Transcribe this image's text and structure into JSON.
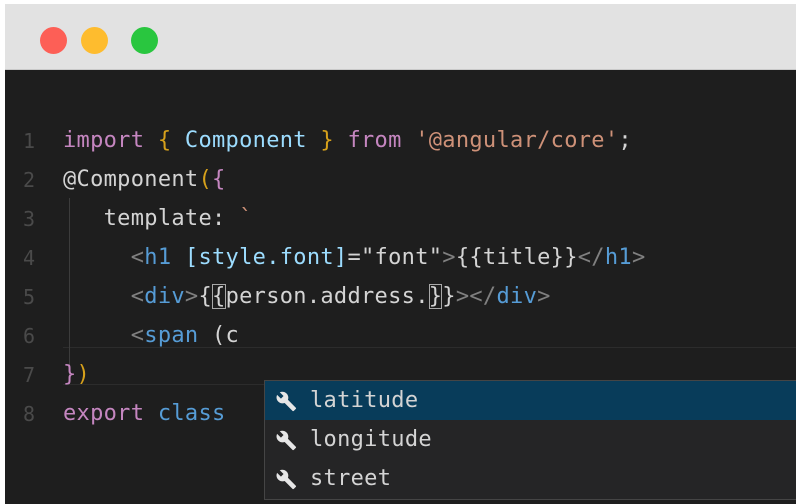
{
  "window": {
    "buttons": {
      "close": "close",
      "minimize": "minimize",
      "zoom": "zoom"
    }
  },
  "editor": {
    "lines": [
      {
        "number": "1",
        "tokens": [
          {
            "text": "import",
            "kind": "kw"
          },
          {
            "text": " ",
            "kind": "pl"
          },
          {
            "text": "{",
            "kind": "br"
          },
          {
            "text": " ",
            "kind": "pl"
          },
          {
            "text": "Component",
            "kind": "ty"
          },
          {
            "text": " ",
            "kind": "pl"
          },
          {
            "text": "}",
            "kind": "br"
          },
          {
            "text": " ",
            "kind": "pl"
          },
          {
            "text": "from",
            "kind": "kw"
          },
          {
            "text": " ",
            "kind": "pl"
          },
          {
            "text": "'@angular/core'",
            "kind": "st"
          },
          {
            "text": ";",
            "kind": "pl"
          }
        ]
      },
      {
        "number": "2",
        "tokens": [
          {
            "text": "@Component",
            "kind": "pl"
          },
          {
            "text": "(",
            "kind": "br"
          },
          {
            "text": "{",
            "kind": "kw"
          }
        ]
      },
      {
        "number": "3",
        "tokens": [
          {
            "text": "   template",
            "kind": "pl"
          },
          {
            "text": ":",
            "kind": "pl"
          },
          {
            "text": " ",
            "kind": "pl"
          },
          {
            "text": "`",
            "kind": "st"
          }
        ]
      },
      {
        "number": "4",
        "tokens": [
          {
            "text": "     <",
            "kind": "tg"
          },
          {
            "text": "h1",
            "kind": "tn"
          },
          {
            "text": " ",
            "kind": "pl"
          },
          {
            "text": "[style.font]",
            "kind": "at"
          },
          {
            "text": "=",
            "kind": "pl"
          },
          {
            "text": "\"font\"",
            "kind": "pl"
          },
          {
            "text": ">",
            "kind": "tg"
          },
          {
            "text": "{{title}}",
            "kind": "pl"
          },
          {
            "text": "</",
            "kind": "tg"
          },
          {
            "text": "h1",
            "kind": "tn"
          },
          {
            "text": ">",
            "kind": "tg"
          }
        ]
      },
      {
        "number": "5",
        "tokens": [
          {
            "text": "     <",
            "kind": "tg"
          },
          {
            "text": "div",
            "kind": "tn"
          },
          {
            "text": ">",
            "kind": "tg"
          },
          {
            "text": "{",
            "kind": "pl"
          },
          {
            "text": "{",
            "kind": "pl",
            "hb": true
          },
          {
            "text": "person.address.",
            "kind": "pl"
          },
          {
            "text": "}",
            "kind": "pl",
            "hb": true
          },
          {
            "text": "}",
            "kind": "pl"
          },
          {
            "text": "></",
            "kind": "tg"
          },
          {
            "text": "div",
            "kind": "tn"
          },
          {
            "text": ">",
            "kind": "tg"
          }
        ]
      },
      {
        "number": "6",
        "tokens": [
          {
            "text": "     <",
            "kind": "tg"
          },
          {
            "text": "span",
            "kind": "tn"
          },
          {
            "text": " (c",
            "kind": "pl"
          }
        ]
      },
      {
        "number": "7",
        "tokens": [
          {
            "text": "}",
            "kind": "kw"
          },
          {
            "text": ")",
            "kind": "br"
          }
        ]
      },
      {
        "number": "8",
        "tokens": [
          {
            "text": "export",
            "kind": "kw"
          },
          {
            "text": " ",
            "kind": "pl"
          },
          {
            "text": "class",
            "kind": "tn"
          }
        ]
      }
    ]
  },
  "suggestions": {
    "items": [
      {
        "label": "latitude",
        "icon": "wrench-icon",
        "selected": true
      },
      {
        "label": "longitude",
        "icon": "wrench-icon",
        "selected": false
      },
      {
        "label": "street",
        "icon": "wrench-icon",
        "selected": false
      }
    ]
  },
  "colors": {
    "editor_bg": "#1e1e1e",
    "titlebar_bg": "#e2e2e2",
    "keyword": "#c586c0",
    "string": "#ce9178",
    "type": "#9cdcfe",
    "tag": "#569cd6",
    "selection": "#083c5a"
  }
}
